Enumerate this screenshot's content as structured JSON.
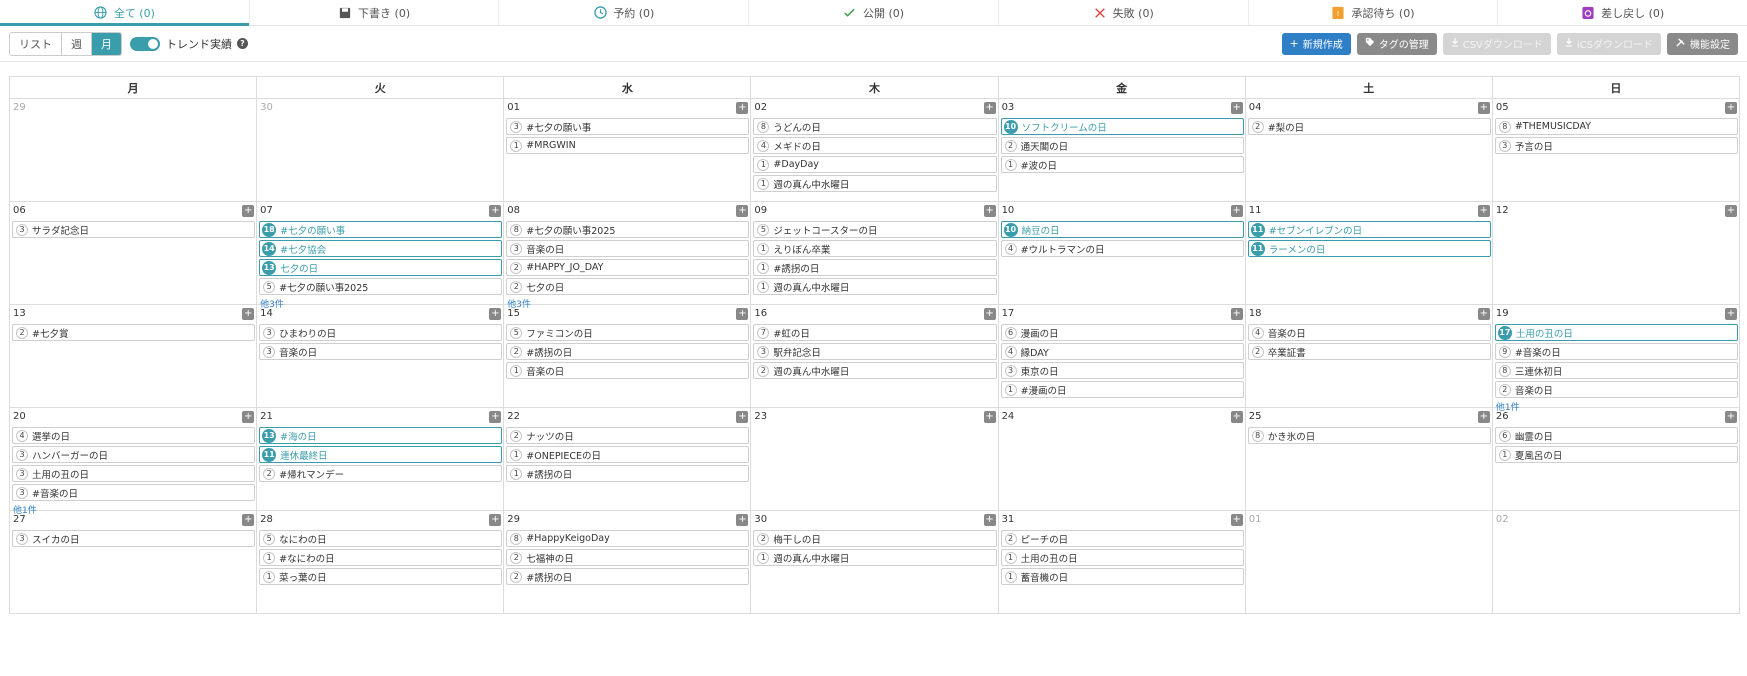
{
  "tabs": [
    {
      "label": "全て (0)",
      "icon": "globe-icon",
      "active": true
    },
    {
      "label": "下書き (0)",
      "icon": "save-icon"
    },
    {
      "label": "予約 (0)",
      "icon": "clock-icon"
    },
    {
      "label": "公開 (0)",
      "icon": "check-icon"
    },
    {
      "label": "失敗 (0)",
      "icon": "x-icon"
    },
    {
      "label": "承認待ち (0)",
      "icon": "approval-icon"
    },
    {
      "label": "差し戻し (0)",
      "icon": "return-icon"
    }
  ],
  "toolbar": {
    "views": [
      "リスト",
      "週",
      "月"
    ],
    "active_view": "月",
    "trend_label": "トレンド実績",
    "help": "?",
    "buttons": [
      {
        "label": "新規作成",
        "icon": "plus-icon",
        "style": "primary"
      },
      {
        "label": "タグの管理",
        "icon": "tag-icon",
        "style": "dark"
      },
      {
        "label": "CSVダウンロード",
        "icon": "download-icon",
        "style": "disabled"
      },
      {
        "label": "iCSダウンロード",
        "icon": "download-icon",
        "style": "disabled"
      },
      {
        "label": "機能設定",
        "icon": "tools-icon",
        "style": "dark"
      }
    ]
  },
  "colors": {
    "accent": "#3a9dab",
    "primary": "#2f7fc7"
  },
  "calendar": {
    "weekdays": [
      "月",
      "火",
      "水",
      "木",
      "金",
      "土",
      "日"
    ],
    "weeks": [
      [
        {
          "num": "29",
          "other": true,
          "events": []
        },
        {
          "num": "30",
          "other": true,
          "events": []
        },
        {
          "num": "01",
          "events": [
            {
              "c": "3",
              "t": "#七夕の願い事"
            },
            {
              "c": "1",
              "t": "#MRGWIN"
            }
          ]
        },
        {
          "num": "02",
          "events": [
            {
              "c": "8",
              "t": "うどんの日"
            },
            {
              "c": "4",
              "t": "メギドの日"
            },
            {
              "c": "1",
              "t": "#DayDay"
            },
            {
              "c": "1",
              "t": "週の真ん中水曜日"
            }
          ]
        },
        {
          "num": "03",
          "events": [
            {
              "c": "10",
              "t": "ソフトクリームの日",
              "hl": true
            },
            {
              "c": "2",
              "t": "通天閣の日"
            },
            {
              "c": "1",
              "t": "#波の日"
            }
          ]
        },
        {
          "num": "04",
          "events": [
            {
              "c": "2",
              "t": "#梨の日"
            }
          ]
        },
        {
          "num": "05",
          "events": [
            {
              "c": "8",
              "t": "#THEMUSICDAY"
            },
            {
              "c": "3",
              "t": "予言の日"
            }
          ]
        }
      ],
      [
        {
          "num": "06",
          "events": [
            {
              "c": "3",
              "t": "サラダ記念日"
            }
          ]
        },
        {
          "num": "07",
          "events": [
            {
              "c": "18",
              "t": "#七夕の願い事",
              "hl": true
            },
            {
              "c": "14",
              "t": "#七夕協会",
              "hl": true
            },
            {
              "c": "13",
              "t": "七夕の日",
              "hl": true
            },
            {
              "c": "5",
              "t": "#七夕の願い事2025"
            }
          ],
          "more": "他3件"
        },
        {
          "num": "08",
          "events": [
            {
              "c": "8",
              "t": "#七夕の願い事2025"
            },
            {
              "c": "3",
              "t": "音楽の日"
            },
            {
              "c": "2",
              "t": "#HAPPY_JO_DAY"
            },
            {
              "c": "2",
              "t": "七夕の日"
            }
          ],
          "more": "他3件"
        },
        {
          "num": "09",
          "events": [
            {
              "c": "5",
              "t": "ジェットコースターの日"
            },
            {
              "c": "1",
              "t": "えりぼん卒業"
            },
            {
              "c": "1",
              "t": "#誘拐の日"
            },
            {
              "c": "1",
              "t": "週の真ん中水曜日"
            }
          ]
        },
        {
          "num": "10",
          "events": [
            {
              "c": "10",
              "t": "納豆の日",
              "hl": true
            },
            {
              "c": "4",
              "t": "#ウルトラマンの日"
            }
          ]
        },
        {
          "num": "11",
          "events": [
            {
              "c": "11",
              "t": "#セブンイレブンの日",
              "hl": true
            },
            {
              "c": "11",
              "t": "ラーメンの日",
              "hl": true
            }
          ]
        },
        {
          "num": "12",
          "events": []
        }
      ],
      [
        {
          "num": "13",
          "events": [
            {
              "c": "2",
              "t": "#七夕賞"
            }
          ]
        },
        {
          "num": "14",
          "events": [
            {
              "c": "3",
              "t": "ひまわりの日"
            },
            {
              "c": "3",
              "t": "音楽の日"
            }
          ]
        },
        {
          "num": "15",
          "events": [
            {
              "c": "5",
              "t": "ファミコンの日"
            },
            {
              "c": "2",
              "t": "#誘拐の日"
            },
            {
              "c": "1",
              "t": "音楽の日"
            }
          ]
        },
        {
          "num": "16",
          "events": [
            {
              "c": "7",
              "t": "#虹の日"
            },
            {
              "c": "3",
              "t": "駅弁記念日"
            },
            {
              "c": "2",
              "t": "週の真ん中水曜日"
            }
          ]
        },
        {
          "num": "17",
          "events": [
            {
              "c": "6",
              "t": "漫画の日"
            },
            {
              "c": "4",
              "t": "縁DAY"
            },
            {
              "c": "3",
              "t": "東京の日"
            },
            {
              "c": "1",
              "t": "#漫画の日"
            }
          ]
        },
        {
          "num": "18",
          "events": [
            {
              "c": "4",
              "t": "音楽の日"
            },
            {
              "c": "2",
              "t": "卒業証書"
            }
          ]
        },
        {
          "num": "19",
          "events": [
            {
              "c": "17",
              "t": "土用の丑の日",
              "hl": true
            },
            {
              "c": "9",
              "t": "#音楽の日"
            },
            {
              "c": "8",
              "t": "三連休初日"
            },
            {
              "c": "2",
              "t": "音楽の日"
            }
          ],
          "more": "他1件"
        }
      ],
      [
        {
          "num": "20",
          "events": [
            {
              "c": "4",
              "t": "選挙の日"
            },
            {
              "c": "3",
              "t": "ハンバーガーの日"
            },
            {
              "c": "3",
              "t": "土用の丑の日"
            },
            {
              "c": "3",
              "t": "#音楽の日"
            }
          ],
          "more": "他1件"
        },
        {
          "num": "21",
          "events": [
            {
              "c": "13",
              "t": "#海の日",
              "hl": true
            },
            {
              "c": "11",
              "t": "連休最終日",
              "hl": true
            },
            {
              "c": "2",
              "t": "#帰れマンデー"
            }
          ]
        },
        {
          "num": "22",
          "events": [
            {
              "c": "2",
              "t": "ナッツの日"
            },
            {
              "c": "1",
              "t": "#ONEPIECEの日"
            },
            {
              "c": "1",
              "t": "#誘拐の日"
            }
          ]
        },
        {
          "num": "23",
          "events": []
        },
        {
          "num": "24",
          "events": []
        },
        {
          "num": "25",
          "events": [
            {
              "c": "8",
              "t": "かき氷の日"
            }
          ]
        },
        {
          "num": "26",
          "events": [
            {
              "c": "6",
              "t": "幽霊の日"
            },
            {
              "c": "1",
              "t": "夏風呂の日"
            }
          ]
        }
      ],
      [
        {
          "num": "27",
          "events": [
            {
              "c": "3",
              "t": "スイカの日"
            }
          ]
        },
        {
          "num": "28",
          "events": [
            {
              "c": "5",
              "t": "なにわの日"
            },
            {
              "c": "1",
              "t": "#なにわの日"
            },
            {
              "c": "1",
              "t": "菜っ葉の日"
            }
          ]
        },
        {
          "num": "29",
          "events": [
            {
              "c": "8",
              "t": "#HappyKeigoDay"
            },
            {
              "c": "2",
              "t": "七福神の日"
            },
            {
              "c": "2",
              "t": "#誘拐の日"
            }
          ]
        },
        {
          "num": "30",
          "events": [
            {
              "c": "2",
              "t": "梅干しの日"
            },
            {
              "c": "1",
              "t": "週の真ん中水曜日"
            }
          ]
        },
        {
          "num": "31",
          "events": [
            {
              "c": "2",
              "t": "ピーチの日"
            },
            {
              "c": "1",
              "t": "土用の丑の日"
            },
            {
              "c": "1",
              "t": "蓄音機の日"
            }
          ]
        },
        {
          "num": "01",
          "other": true,
          "events": []
        },
        {
          "num": "02",
          "other": true,
          "events": []
        }
      ]
    ]
  }
}
